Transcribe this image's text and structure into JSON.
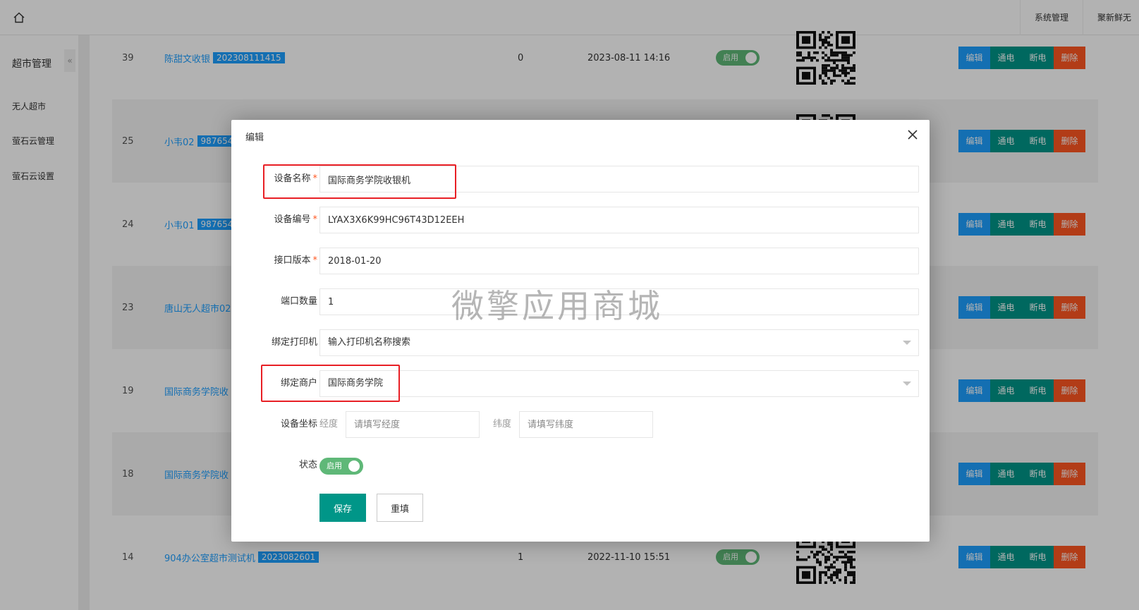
{
  "topbar": {
    "menu": [
      "系统管理",
      "聚新鲜无"
    ]
  },
  "sidebar": {
    "title": "超市管理",
    "collapse_glyph": "«",
    "items": [
      "无人超市",
      "萤石云管理",
      "萤石云设置"
    ]
  },
  "table": {
    "ops": {
      "edit": "编辑",
      "power_on": "通电",
      "power_off": "断电",
      "delete": "删除"
    },
    "switch_label": "启用",
    "rows": [
      {
        "id": "39",
        "name": "陈甜文收银",
        "code": "202308111415",
        "count": "0",
        "time": "2023-08-11 14:16",
        "switch": true
      },
      {
        "id": "25",
        "name": "小韦02",
        "code": "987654",
        "count": "",
        "time": "",
        "switch": false
      },
      {
        "id": "24",
        "name": "小韦01",
        "code": "987654",
        "count": "",
        "time": "",
        "switch": false
      },
      {
        "id": "23",
        "name": "唐山无人超市02",
        "code": "",
        "count": "",
        "time": "",
        "switch": false
      },
      {
        "id": "19",
        "name": "国际商务学院收",
        "code": "",
        "count": "",
        "time": "",
        "switch": false
      },
      {
        "id": "18",
        "name": "国际商务学院收",
        "code": "",
        "count": "",
        "time": "",
        "switch": false
      },
      {
        "id": "14",
        "name": "904办公室超市测试机",
        "code": "2023082601",
        "count": "1",
        "time": "2022-11-10 15:51",
        "switch": true
      }
    ]
  },
  "modal": {
    "title": "编辑",
    "fields": {
      "device_name": {
        "label": "设备名称",
        "value": "国际商务学院收银机"
      },
      "device_sn": {
        "label": "设备编号",
        "value": "LYAX3X6K99HC96T43D12EEH"
      },
      "api_version": {
        "label": "接口版本",
        "value": "2018-01-20"
      },
      "port_count": {
        "label": "端口数量",
        "value": "1"
      },
      "printer": {
        "label": "绑定打印机",
        "placeholder": "输入打印机名称搜索"
      },
      "merchant": {
        "label": "绑定商户",
        "value": "国际商务学院"
      },
      "coords": {
        "label": "设备坐标",
        "lng_label": "经度",
        "lng_placeholder": "请填写经度",
        "lat_label": "纬度",
        "lat_placeholder": "请填写纬度"
      },
      "status": {
        "label": "状态",
        "switch_label": "启用"
      }
    },
    "required_mark": "*",
    "save_label": "保存",
    "reset_label": "重填"
  },
  "watermark": "微擎应用商城",
  "colors": {
    "primary": "#009688",
    "blue": "#1e9fff",
    "danger": "#ff5722",
    "switch_on": "#5fb878",
    "highlight": "#e81f25"
  }
}
